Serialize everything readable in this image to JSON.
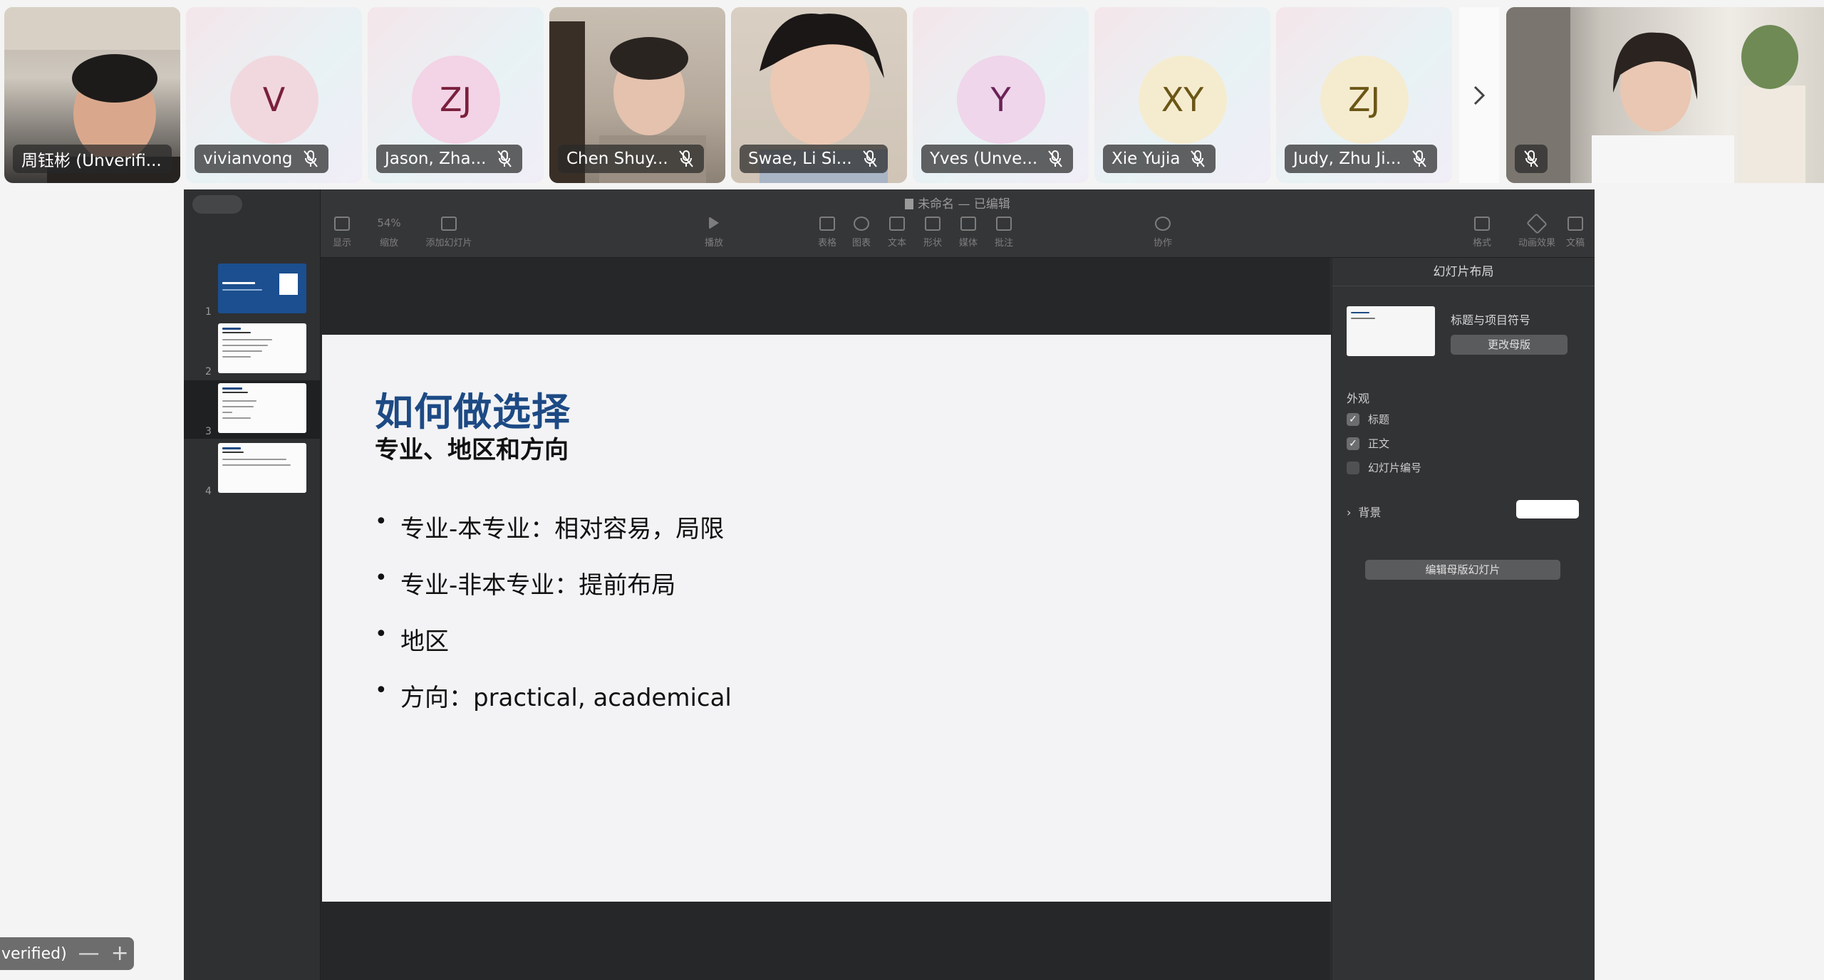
{
  "participants": [
    {
      "name": "周钰彬 (Unverifi...",
      "type": "video",
      "muted": false
    },
    {
      "name": "vivianvong",
      "initials": "V",
      "avatar_bg": "#f1d8df",
      "avatar_fg": "#7a1f3c",
      "muted": true
    },
    {
      "name": "Jason, Zha...",
      "initials": "ZJ",
      "avatar_bg": "#f3d3e6",
      "avatar_fg": "#7a1f3c",
      "muted": true
    },
    {
      "name": "Chen Shuy...",
      "type": "video",
      "muted": true
    },
    {
      "name": "Swae, Li Si...",
      "type": "video",
      "muted": true
    },
    {
      "name": "Yves (Unve...",
      "initials": "Y",
      "avatar_bg": "#efd6ea",
      "avatar_fg": "#6a2358",
      "muted": true
    },
    {
      "name": "Xie Yujia",
      "initials": "XY",
      "avatar_bg": "#f5ecd0",
      "avatar_fg": "#6b5616",
      "muted": true
    },
    {
      "name": "Judy, Zhu Ji...",
      "initials": "ZJ",
      "avatar_bg": "#f5ebcf",
      "avatar_fg": "#6b5616",
      "muted": true
    },
    {
      "name": "",
      "type": "video",
      "muted": true
    }
  ],
  "next_page_icon": "chevron-right",
  "keynote": {
    "doc_title": "未命名 — 已编辑",
    "toolbar": {
      "view": "显示",
      "zoom_value": "54%",
      "zoom": "缩放",
      "add_slide": "添加幻灯片",
      "play": "播放",
      "table": "表格",
      "chart": "图表",
      "text": "文本",
      "shape": "形状",
      "media": "媒体",
      "comment": "批注",
      "collaborate": "协作",
      "format": "格式",
      "animate": "动画效果",
      "document": "文稿"
    },
    "slide_numbers": [
      "1",
      "2",
      "3",
      "4"
    ],
    "selected_slide": 3,
    "slide": {
      "title": "如何做选择",
      "subtitle": "专业、地区和方向",
      "bullets": [
        "专业-本专业：相对容易，局限",
        "专业-非本专业：提前布局",
        "地区",
        "方向：practical, academical"
      ]
    },
    "inspector": {
      "header": "幻灯片布局",
      "layout_name": "标题与项目符号",
      "change_master": "更改母版",
      "appearance": "外观",
      "options": [
        {
          "label": "标题",
          "checked": true
        },
        {
          "label": "正文",
          "checked": true
        },
        {
          "label": "幻灯片编号",
          "checked": false
        }
      ],
      "background": "背景",
      "edit_master": "编辑母版幻灯片"
    }
  },
  "self_view": {
    "label": "verified)",
    "minus": "—",
    "plus": "+"
  }
}
